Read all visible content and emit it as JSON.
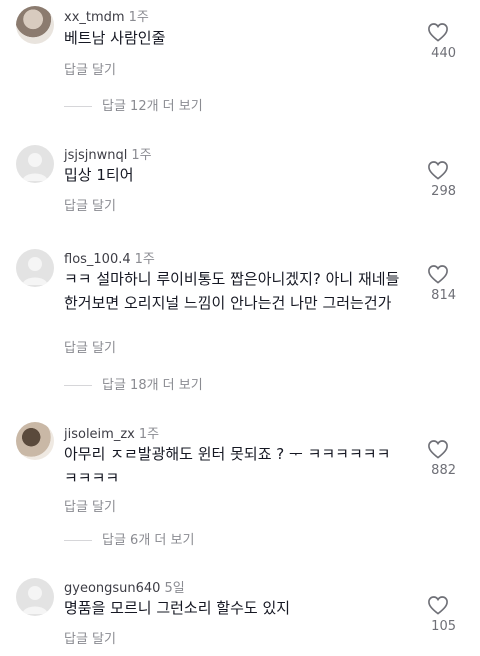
{
  "comments": [
    {
      "user": "xx_tmdm",
      "time": "1주",
      "text": "베트남 사람인줄",
      "reply": "답글 달기",
      "likes": "440",
      "view_replies": "답글 12개 더 보기"
    },
    {
      "user": "jsjsjnwnql",
      "time": "1주",
      "text": "밉상 1티어",
      "reply": "답글 달기",
      "likes": "298"
    },
    {
      "user": "flos_100.4",
      "time": "1주",
      "text": "ㅋㅋ 설마하니 루이비통도 짭은아니겠지? 아니 재네들 한거보면 오리지널 느낌이 안나는건 나만 그러는건가",
      "reply": "답글 달기",
      "likes": "814",
      "view_replies": "답글 18개 더 보기"
    },
    {
      "user": "jisoleim_zx",
      "time": "1주",
      "text": "아무리 ㅈㄹ발광해도 윈터 못되죠 ? ᅮ ㅋㅋㅋㅋㅋㅋ ㅋㅋㅋㅋ",
      "reply": "답글 달기",
      "likes": "882",
      "view_replies": "답글 6개 더 보기"
    },
    {
      "user": "gyeongsun640",
      "time": "5일",
      "text": "명품을 모르니 그런소리 할수도 있지",
      "reply": "답글 달기",
      "likes": "105"
    }
  ]
}
